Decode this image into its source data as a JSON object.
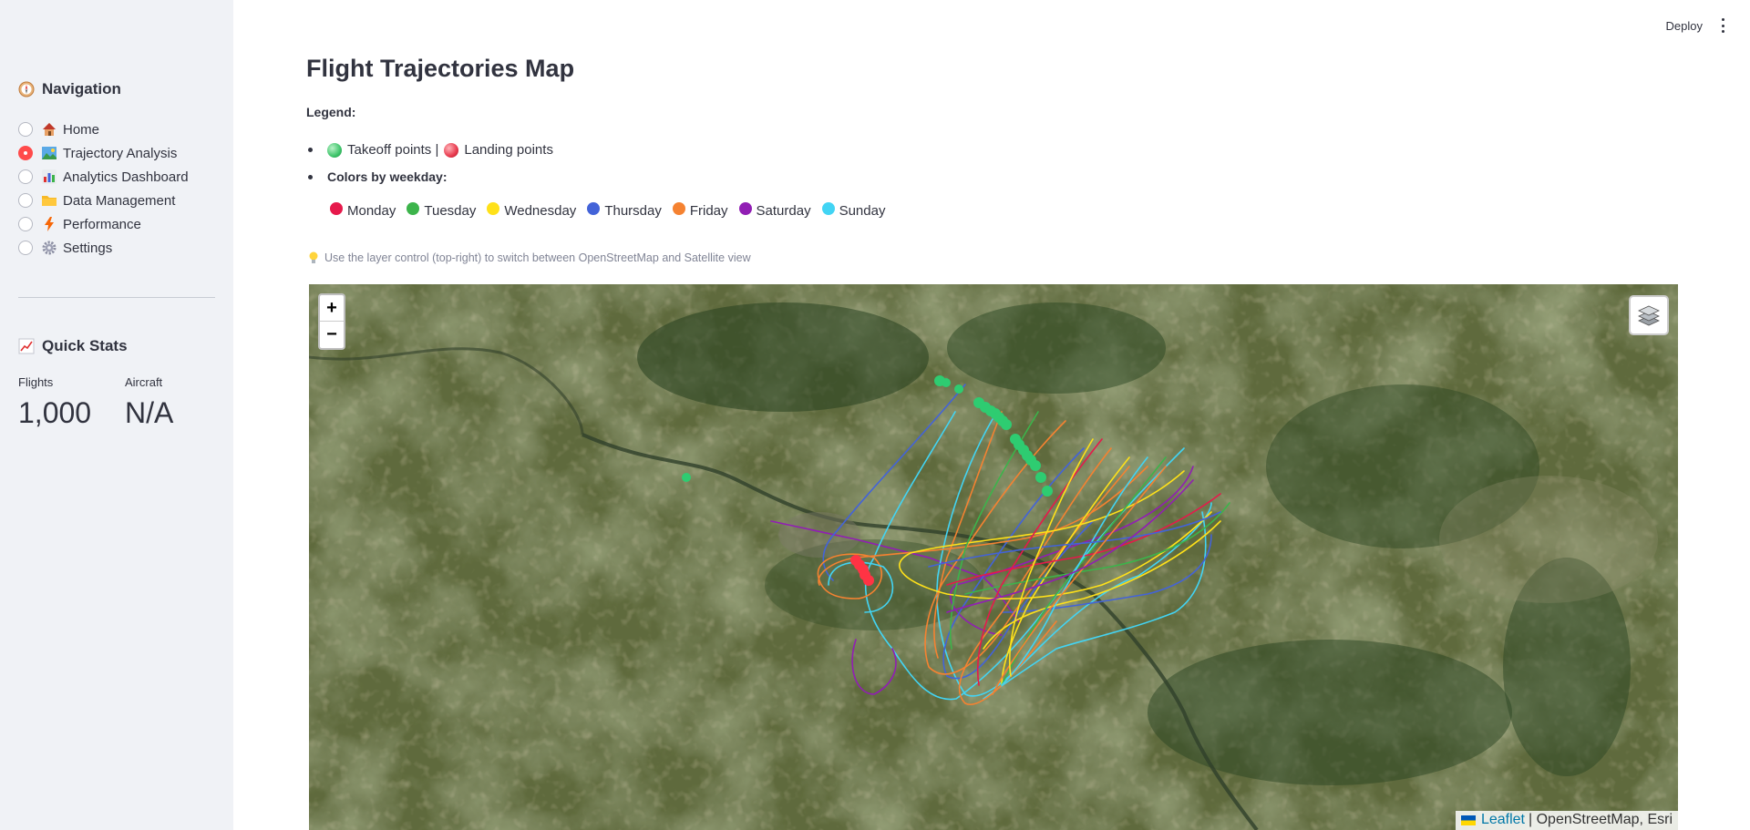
{
  "sidebar": {
    "nav_title": "Navigation",
    "items": [
      {
        "label": "Home",
        "icon": "house-icon",
        "selected": false
      },
      {
        "label": "Trajectory Analysis",
        "icon": "landscape-image-icon",
        "selected": true
      },
      {
        "label": "Analytics Dashboard",
        "icon": "bar-chart-icon",
        "selected": false
      },
      {
        "label": "Data Management",
        "icon": "folder-icon",
        "selected": false
      },
      {
        "label": "Performance",
        "icon": "lightning-icon",
        "selected": false
      },
      {
        "label": "Settings",
        "icon": "gear-icon",
        "selected": false
      }
    ],
    "stats_title": "Quick Stats",
    "metrics": [
      {
        "label": "Flights",
        "value": "1,000"
      },
      {
        "label": "Aircraft",
        "value": "N/A"
      }
    ]
  },
  "header": {
    "deploy_label": "Deploy"
  },
  "main": {
    "title": "Flight Trajectories Map",
    "legend_label": "Legend:",
    "takeoff_label": "Takeoff points |",
    "landing_label": "Landing points",
    "weekday_heading": "Colors by weekday:",
    "weekdays": [
      {
        "label": "Monday",
        "color": "#e6194b"
      },
      {
        "label": "Tuesday",
        "color": "#3cb44b"
      },
      {
        "label": "Wednesday",
        "color": "#ffe119"
      },
      {
        "label": "Thursday",
        "color": "#4363d8"
      },
      {
        "label": "Friday",
        "color": "#f58231"
      },
      {
        "label": "Saturday",
        "color": "#911eb4"
      },
      {
        "label": "Sunday",
        "color": "#42d4f4"
      }
    ],
    "hint": "Use the layer control (top-right) to switch between OpenStreetMap and Satellite view"
  },
  "map": {
    "zoom_in": "+",
    "zoom_out": "−",
    "attribution_link": "Leaflet",
    "attribution_text": "| OpenStreetMap, Esri",
    "takeoff_color": "#2ecc71",
    "landing_color": "#ff3344"
  }
}
